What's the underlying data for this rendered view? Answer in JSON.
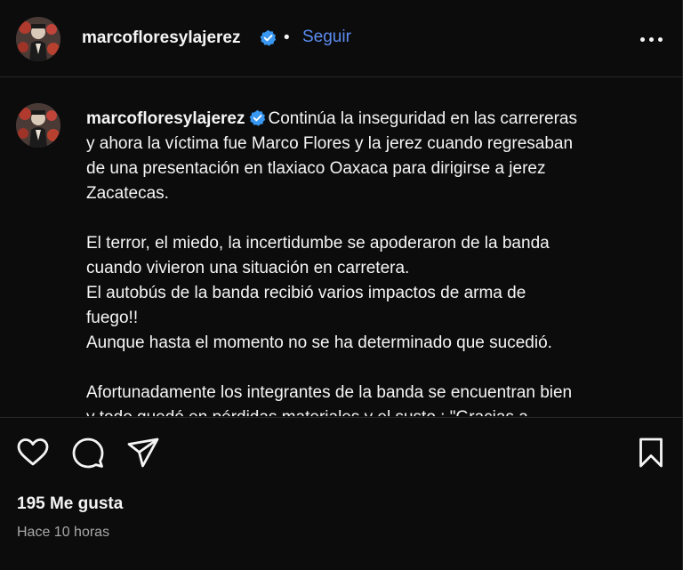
{
  "header": {
    "username": "marcofloresylajerez",
    "separator": "•",
    "follow_label": "Seguir",
    "more_icon": "more-horizontal-icon"
  },
  "caption": {
    "username": "marcofloresylajerez",
    "lines_p1": [
      "Continúa la inseguridad en las carrereras",
      "y ahora la víctima fue Marco Flores y la jerez cuando regresaban",
      "de una presentación en tlaxiaco Oaxaca para dirigirse a jerez",
      "Zacatecas."
    ],
    "lines_p2": [
      "El terror, el miedo, la incertidumbe se apoderaron de la banda",
      "cuando vivieron una situación en carretera.",
      "El autobús de la banda recibió varios impactos de arma de",
      "fuego!!",
      "Aunque hasta el momento no se ha determinado que sucedió."
    ],
    "lines_p3": [
      "Afortunadamente los integrantes de la banda se encuentran bien",
      "y todo quedó en pérdidas materiales y el susto : \"Gracias a"
    ]
  },
  "actions": {
    "like_icon": "heart-icon",
    "comment_icon": "comment-icon",
    "share_icon": "send-icon",
    "save_icon": "bookmark-icon"
  },
  "stats": {
    "likes": "195 Me gusta",
    "time": "Hace 10 horas"
  },
  "colors": {
    "background": "#0c0c0d",
    "text": "#f5f5f5",
    "follow": "#5b8cf0",
    "verified": "#3897f0",
    "muted": "#a8a8a8"
  }
}
